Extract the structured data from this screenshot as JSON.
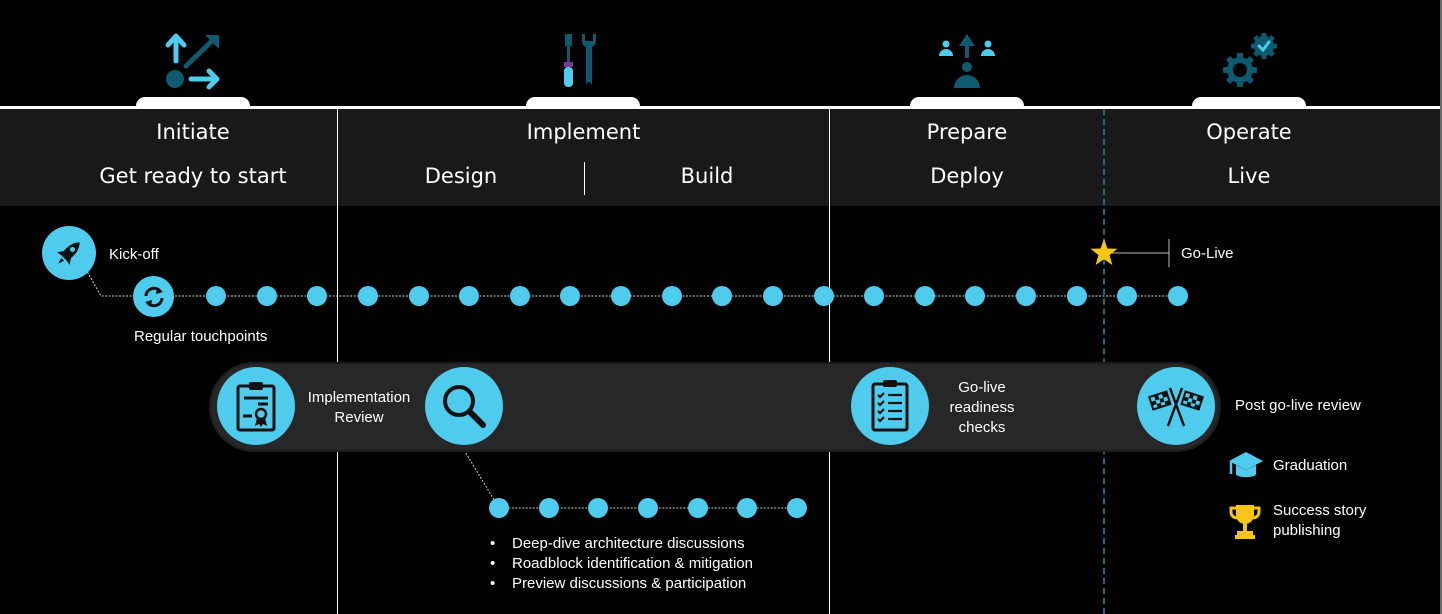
{
  "phases": [
    {
      "title": "Initiate",
      "subtitle": "Get ready to start",
      "icon": "arrows-outward-icon"
    },
    {
      "title": "Implement",
      "subphases": [
        "Design",
        "Build"
      ],
      "icon": "tools-icon"
    },
    {
      "title": "Prepare",
      "subtitle": "Deploy",
      "icon": "people-upgrade-icon"
    },
    {
      "title": "Operate",
      "subtitle": "Live",
      "icon": "gear-check-icon"
    }
  ],
  "milestones": {
    "kickoff": "Kick-off",
    "touchpoints": "Regular touchpoints",
    "go_live": "Go-Live"
  },
  "reviews": {
    "implementation_review": [
      "Implementation",
      "Review"
    ],
    "go_live_readiness": [
      "Go-live",
      "readiness",
      "checks"
    ],
    "post_go_live": "Post go-live review"
  },
  "deep_dive_bullets": [
    "Deep-dive architecture discussions",
    "Roadblock identification & mitigation",
    "Preview discussions & participation"
  ],
  "outcomes": {
    "graduation": "Graduation",
    "success_story": [
      "Success story",
      "publishing"
    ]
  },
  "timeline": {
    "main_dot_count": 20,
    "deep_dive_dot_count": 7
  },
  "colors": {
    "accent": "#4ecbed",
    "dark_teal": "#0f5a70",
    "star": "#f5c518",
    "band": "#191919"
  }
}
